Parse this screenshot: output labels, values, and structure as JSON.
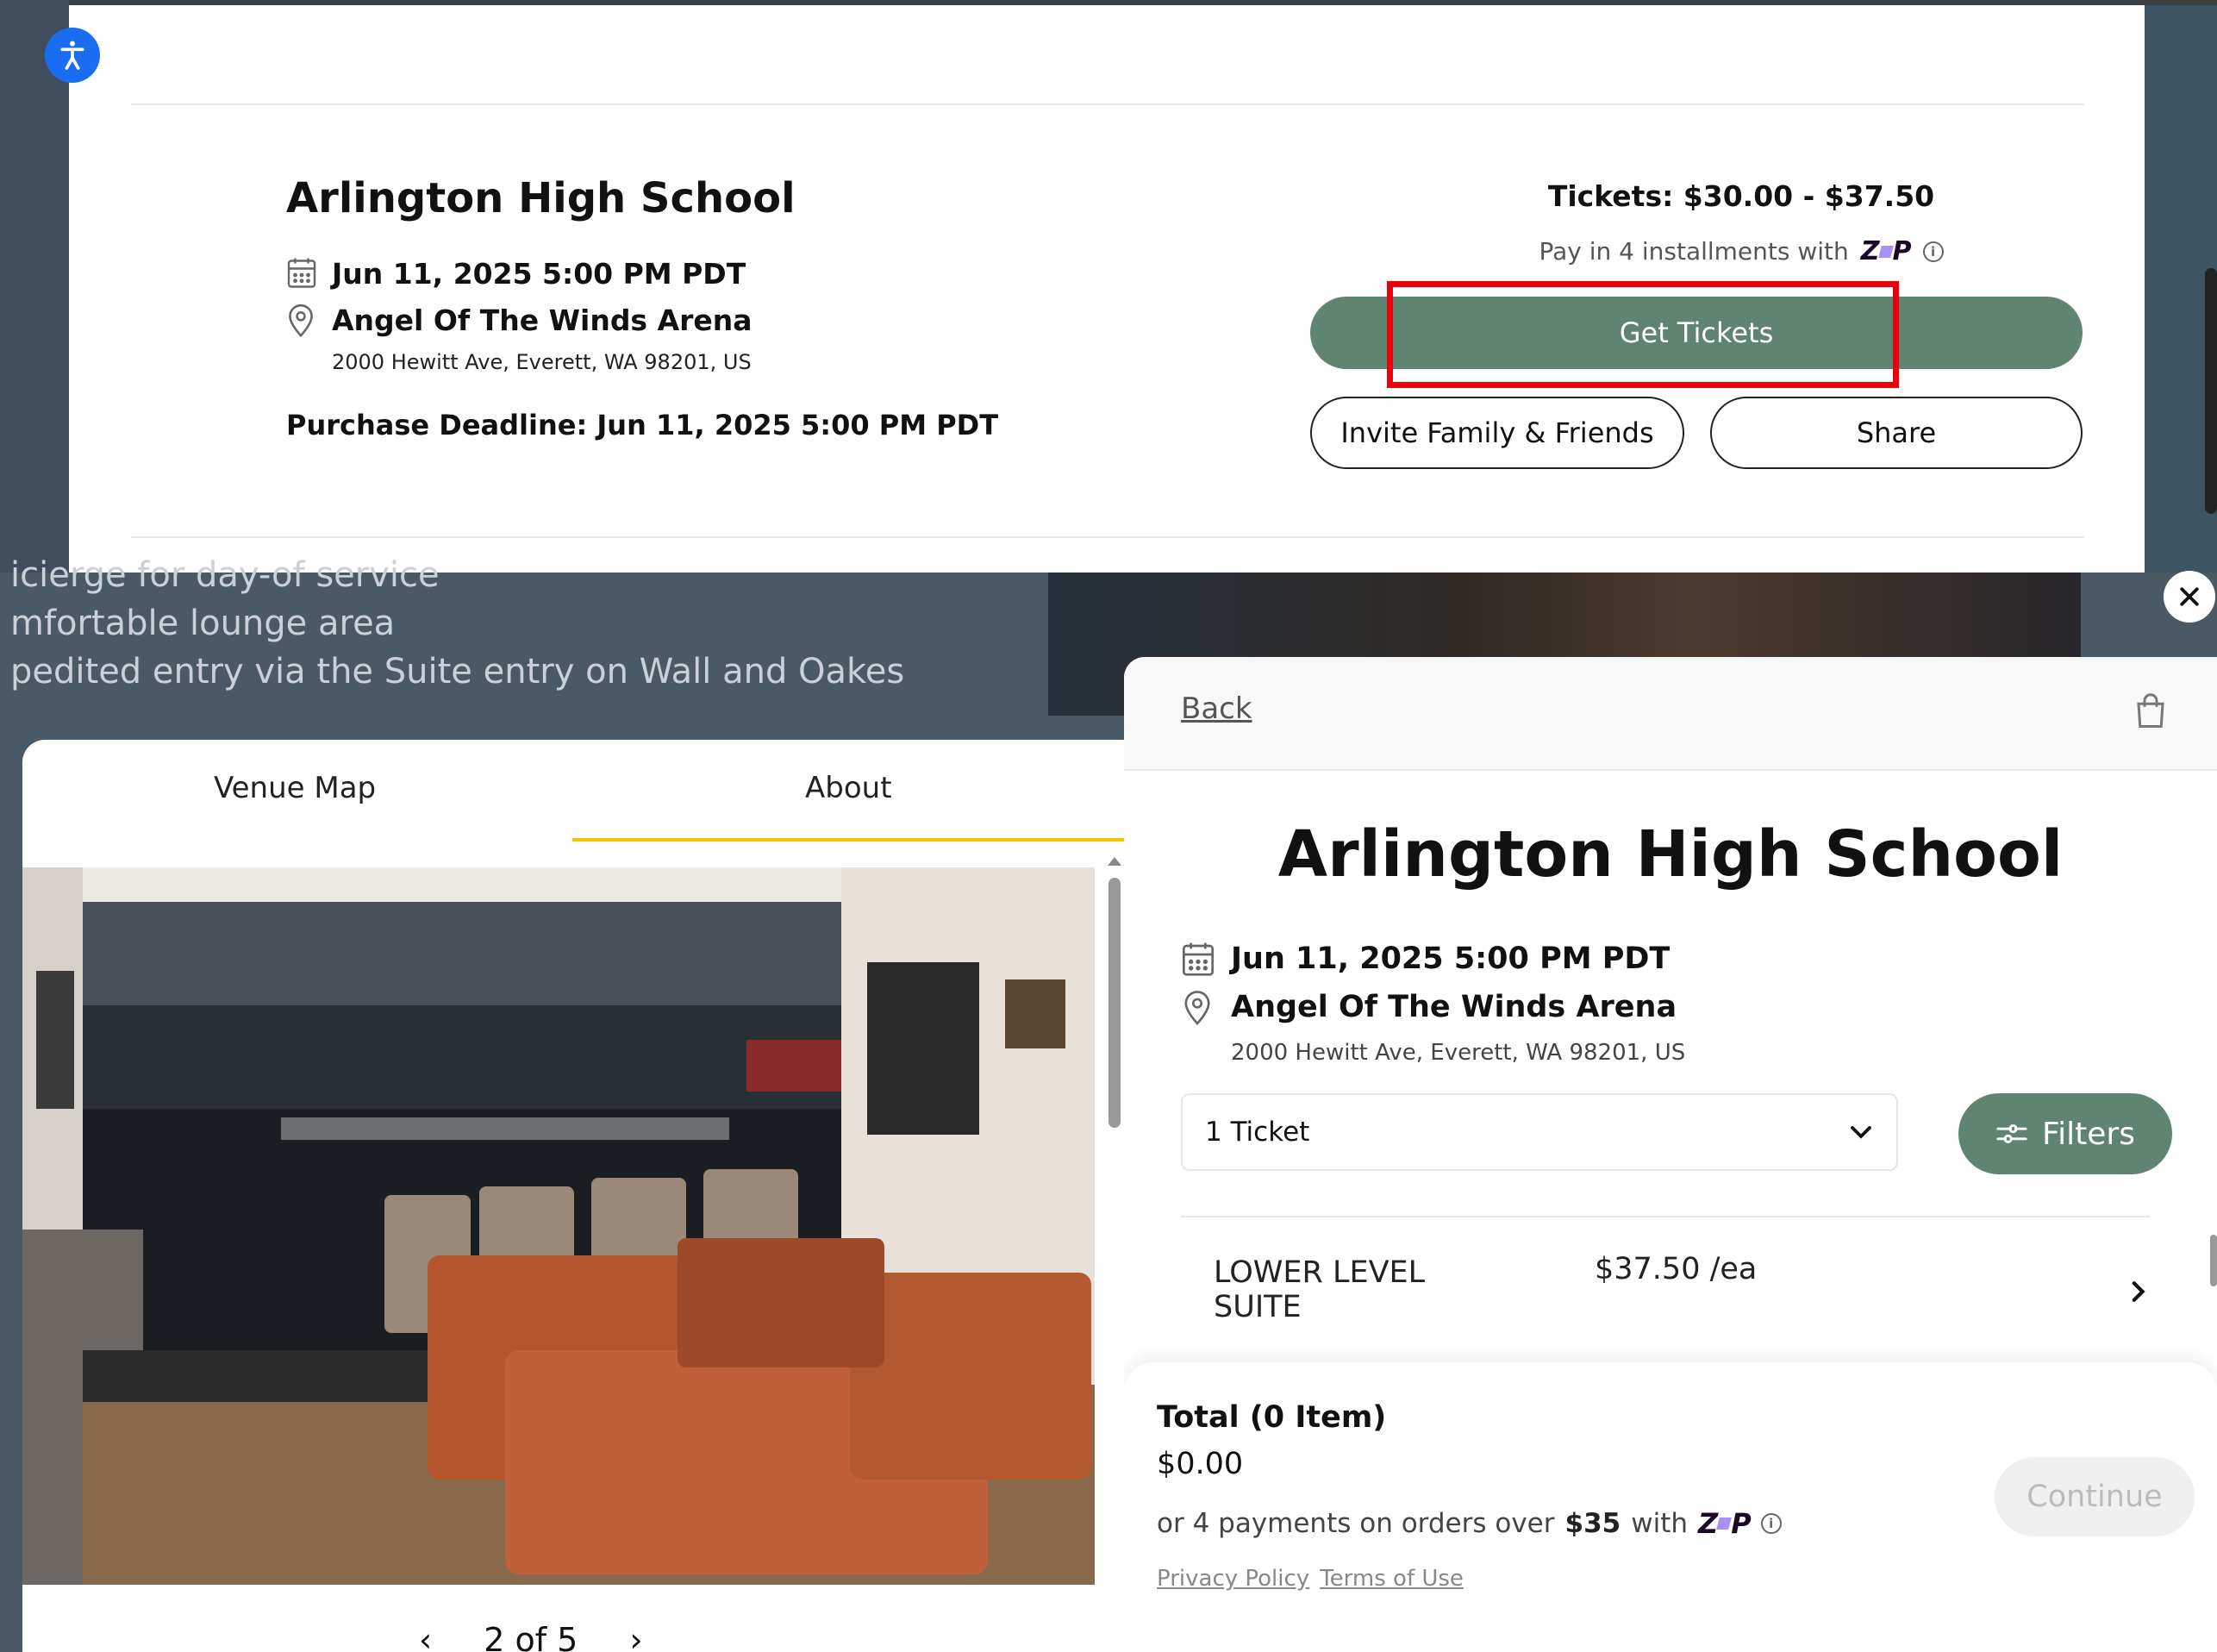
{
  "event_card": {
    "title": "Arlington High School",
    "date": "Jun 11, 2025 5:00 PM PDT",
    "venue": "Angel Of The Winds Arena",
    "address": "2000 Hewitt Ave, Everett, WA 98201, US",
    "deadline": "Purchase Deadline: Jun 11, 2025 5:00 PM PDT",
    "price_range": "Tickets: $30.00 - $37.50",
    "pay_text": "Pay in 4 installments with",
    "get_tickets": "Get Tickets",
    "invite": "Invite Family & Friends",
    "share": "Share"
  },
  "background_text": {
    "line1": "icierge for day-of service",
    "line2": "mfortable lounge area",
    "line3": "pedited entry via the Suite entry on Wall and Oakes"
  },
  "venue_panel": {
    "tabs": [
      "Venue Map",
      "About"
    ],
    "active_tab": "About",
    "pager": "2 of 5",
    "prev": "‹",
    "next": "›"
  },
  "tickets_panel": {
    "back": "Back",
    "title": "Arlington High School",
    "date": "Jun 11, 2025 5:00 PM PDT",
    "venue": "Angel Of The Winds Arena",
    "address": "2000 Hewitt Ave, Everett, WA 98201, US",
    "quantity": "1 Ticket",
    "filters": "Filters",
    "section": {
      "name": "LOWER LEVEL SUITE",
      "price": "$37.50 /ea"
    },
    "total_label": "Total (0 Item)",
    "total_value": "$0.00",
    "pay_note_prefix": "or 4 payments on orders over",
    "pay_note_amount": "$35",
    "pay_note_suffix": "with",
    "continue": "Continue",
    "privacy": "Privacy Policy",
    "terms": "Terms of Use"
  },
  "zip_brand": {
    "letters_left": "Z",
    "letters_right": "P"
  },
  "colors": {
    "accent_green": "#5f8472",
    "highlight_red": "#e8000d",
    "tab_underline": "#f4c400",
    "accessibility_blue": "#1a6cf0"
  },
  "icons": [
    "accessibility-icon",
    "calendar-icon",
    "location-pin-icon",
    "info-icon",
    "close-icon",
    "cart-icon",
    "chevron-down-icon",
    "filter-icon",
    "chevron-right-icon",
    "chevron-left-icon"
  ]
}
